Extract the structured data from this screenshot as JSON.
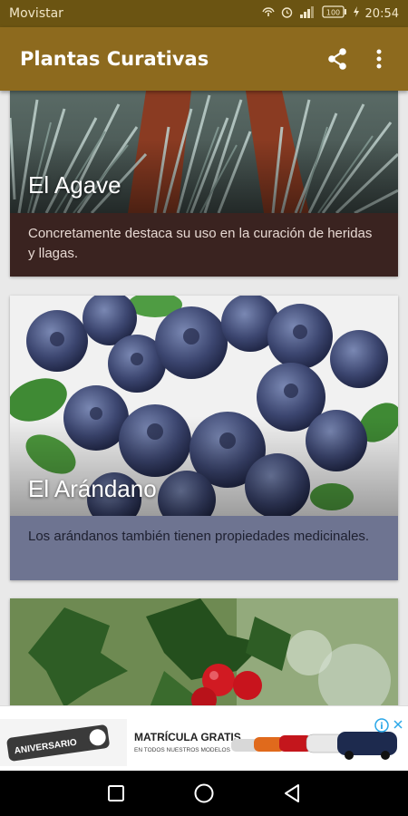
{
  "status_bar": {
    "carrier": "Movistar",
    "battery": "100",
    "time": "20:54"
  },
  "app_bar": {
    "title": "Plantas Curativas",
    "share_icon": "share-icon",
    "menu_icon": "more-vert-icon"
  },
  "cards": [
    {
      "title": "El  Agave",
      "description": "Concretamente destaca su uso en la curación de heridas y llagas.",
      "desc_bg": "#3a2320",
      "desc_color": "#e6d8d2"
    },
    {
      "title": "El Arándano",
      "description": "Los arándanos también tienen propiedades medicinales.",
      "desc_bg": "#6e7491",
      "desc_color": "#1e2030"
    },
    {
      "title": "",
      "description": ""
    }
  ],
  "ad": {
    "badge": "ANIVERSARIO",
    "headline": "MATRÍCULA GRATIS",
    "subline": "EN TODOS NUESTROS MODELOS",
    "info_icon": "info-icon",
    "close_icon": "close-icon"
  },
  "nav_bar": {
    "recents_icon": "recents-icon",
    "home_icon": "home-icon",
    "back_icon": "back-icon"
  },
  "colors": {
    "status_bar": "#6b5412",
    "app_bar": "#8d6a1e",
    "background": "#e9e9e9"
  }
}
